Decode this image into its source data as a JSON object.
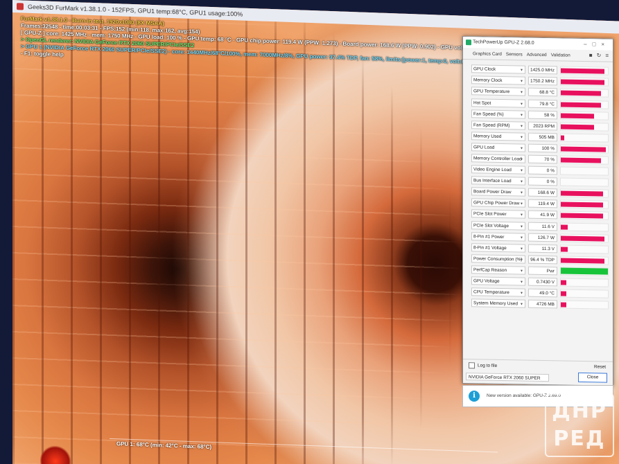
{
  "window": {
    "title": "Geeks3D FurMark v1.38.1.0 - 152FPS, GPU1 temp:68°C, GPU1 usage:100%"
  },
  "furmark": {
    "lines": [
      "FurMark v1.38.1.0 - Burn-in test, 1920x1080 (8X MSAA)",
      "Frames:32548 - time:00:03:31 - FPS:152 (min:118, max:162, avg:154)",
      "[ GPU-Z ] core: 1425 MHz - mem: 1750 MHz - GPU load: 100 % - GPU temp: 68 °C - GPU chip power: 119.4 W (PPW: 1.273) - Board power: 168.6 W (PPW: 0.902) - GPU voltage: 0.743 V",
      "> OpenGL renderer: NVIDIA GeForce RTX 2060 SUPER/PCIe/SSE2",
      "> GPU 1 (NVIDIA GeForce RTX 2060 SUPER/PCIe/SSE2) - core: 1440MHz/68°C/100%, mem: 7000MHz/8%, GPU power: 97.4% TDP, fan: 58%, limits:[power:1, temp:0, volt:0, OV:0]",
      "- F1: toggle help"
    ],
    "graph_label": "GPU 1: 68°C (min: 42°C - max: 68°C)"
  },
  "gpuz": {
    "title": "TechPowerUp GPU-Z 2.68.0",
    "tabs": [
      "Graphics Card",
      "Sensors",
      "Advanced",
      "Validation"
    ],
    "sensors": [
      {
        "label": "GPU Clock",
        "value": "1425.0 MHz",
        "level": 0.92
      },
      {
        "label": "Memory Clock",
        "value": "1750.2 MHz",
        "level": 0.92
      },
      {
        "label": "GPU Temperature",
        "value": "68.8 °C",
        "level": 0.85
      },
      {
        "label": "Hot Spot",
        "value": "79.8 °C",
        "level": 0.85
      },
      {
        "label": "Fan Speed (%)",
        "value": "58 %",
        "level": 0.7
      },
      {
        "label": "Fan Speed (RPM)",
        "value": "2023 RPM",
        "level": 0.7
      },
      {
        "label": "Memory Used",
        "value": "505 MB",
        "level": 0.08
      },
      {
        "label": "GPU Load",
        "value": "100 %",
        "level": 0.95
      },
      {
        "label": "Memory Controller Load",
        "value": "70 %",
        "level": 0.85
      },
      {
        "label": "Video Engine Load",
        "value": "0 %",
        "level": 0
      },
      {
        "label": "Bus Interface Load",
        "value": "0 %",
        "level": 0
      },
      {
        "label": "Board Power Draw",
        "value": "168.6 W",
        "level": 0.9
      },
      {
        "label": "GPU Chip Power Draw",
        "value": "119.4 W",
        "level": 0.9
      },
      {
        "label": "PCIe Slot Power",
        "value": "41.9 W",
        "level": 0.9
      },
      {
        "label": "PCIe Slot Voltage",
        "value": "11.6 V",
        "level": 0.15
      },
      {
        "label": "8-Pin #1 Power",
        "value": "126.7 W",
        "level": 0.92
      },
      {
        "label": "8-Pin #1 Voltage",
        "value": "11.3 V",
        "level": 0.15
      },
      {
        "label": "Power Consumption (%)",
        "value": "96.4 % TDP",
        "level": 0.92
      },
      {
        "label": "PerfCap Reason",
        "value": "Pwr",
        "level": 1.0,
        "color": "#18c43a"
      },
      {
        "label": "GPU Voltage",
        "value": "0.7430 V",
        "level": 0.12
      },
      {
        "label": "CPU Temperature",
        "value": "49.0 °C",
        "level": 0.12
      },
      {
        "label": "System Memory Used",
        "value": "4726 MB",
        "level": 0.12
      }
    ],
    "log_label": "Log to file",
    "reset_label": "Reset",
    "gpu_name": "NVIDIA GeForce RTX 2060 SUPER",
    "close_label": "Close"
  },
  "notice": {
    "icon_text": "i",
    "message": "New version available: GPU-Z 2.69.0"
  },
  "watermark": {
    "line1": "ДНР",
    "line2": "РЕД"
  },
  "colors": {
    "sensor_bar": "#e8115e",
    "perfcap_bar": "#18c43a",
    "info_icon": "#1e9fd6"
  }
}
